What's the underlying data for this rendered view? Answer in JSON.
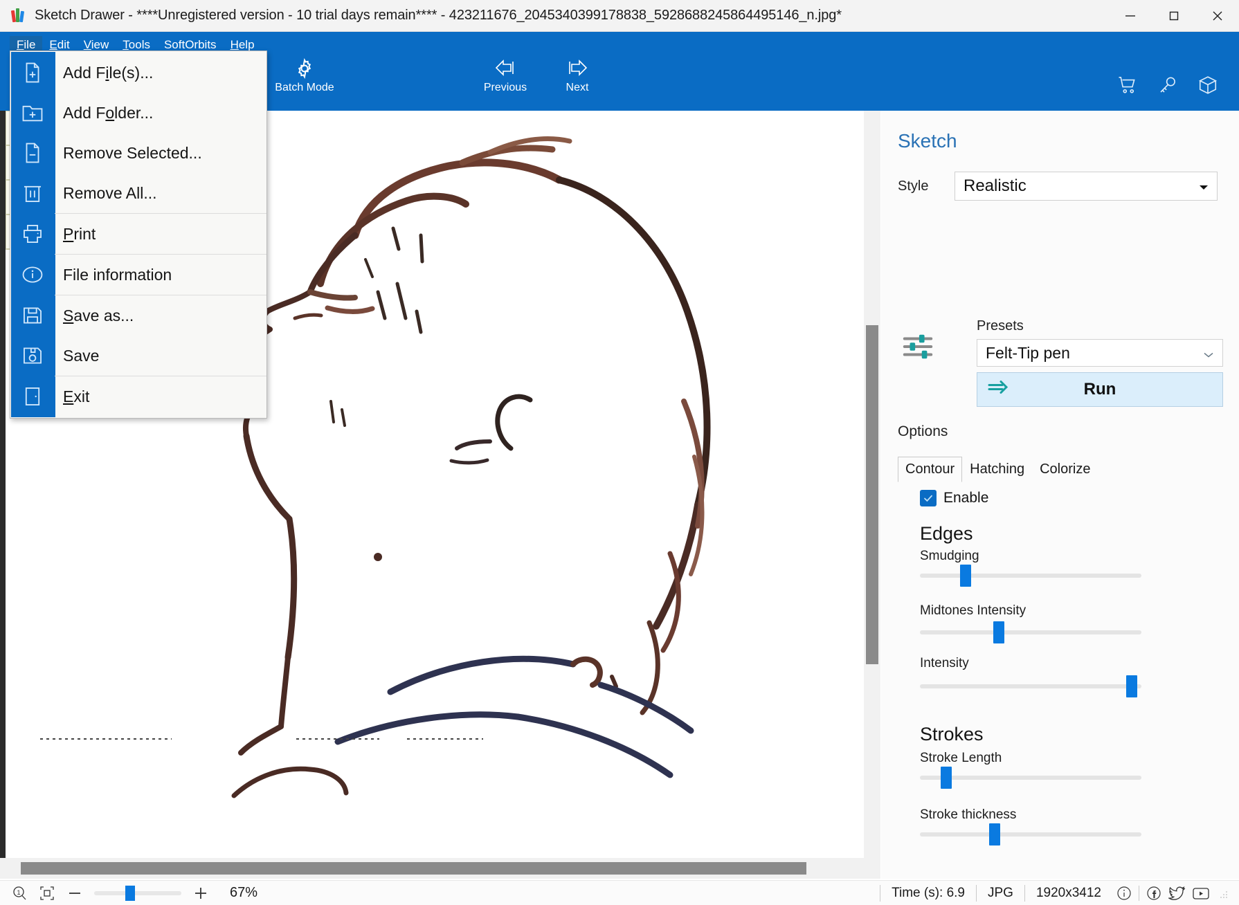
{
  "window": {
    "title": "Sketch Drawer - ****Unregistered version - 10 trial days remain**** - 423211676_2045340399178838_5928688245864495146_n.jpg*",
    "app_icon": "sketch-drawer-logo-icon",
    "minimize": "minimize-icon",
    "maximize": "maximize-icon",
    "close": "close-icon"
  },
  "menubar": {
    "items": [
      {
        "label": "File",
        "mnemonic": "F",
        "active": true
      },
      {
        "label": "Edit",
        "mnemonic": "E",
        "active": false
      },
      {
        "label": "View",
        "mnemonic": "V",
        "active": false
      },
      {
        "label": "Tools",
        "mnemonic": "T",
        "active": false
      },
      {
        "label": "SoftOrbits",
        "mnemonic": "",
        "active": false
      },
      {
        "label": "Help",
        "mnemonic": "H",
        "active": false
      }
    ]
  },
  "file_menu": {
    "items": [
      {
        "label": "Add File(s)...",
        "icon": "file-add-icon",
        "sep_after": false
      },
      {
        "label": "Add Folder...",
        "icon": "folder-add-icon",
        "sep_after": false
      },
      {
        "label": "Remove Selected...",
        "icon": "file-remove-icon",
        "sep_after": false
      },
      {
        "label": "Remove All...",
        "icon": "trash-icon",
        "sep_after": true
      },
      {
        "label": "Print",
        "icon": "printer-icon",
        "sep_after": true
      },
      {
        "label": "File information",
        "icon": "info-circle-icon",
        "sep_after": true
      },
      {
        "label": "Save as...",
        "icon": "save-as-icon",
        "sep_after": false
      },
      {
        "label": "Save",
        "icon": "save-icon",
        "sep_after": true
      },
      {
        "label": "Exit",
        "icon": "exit-door-icon",
        "sep_after": false
      }
    ]
  },
  "toolbar": {
    "batch_mode_line1": "Batch",
    "batch_mode_line2": "Mode",
    "batch_mode_icon": "gear-icon",
    "previous_label": "Previous",
    "previous_icon": "arrow-left-icon",
    "next_label": "Next",
    "next_icon": "arrow-right-icon",
    "right_icons": [
      "cart-icon",
      "key-icon",
      "box-icon"
    ]
  },
  "panel": {
    "title": "Sketch",
    "style_label": "Style",
    "style_value": "Realistic",
    "presets_label": "Presets",
    "presets_value": "Felt-Tip pen",
    "presets_icon": "sliders-icon",
    "run_label": "Run",
    "run_icon": "arrow-right-double-icon",
    "options_label": "Options",
    "tabs": [
      {
        "label": "Contour",
        "selected": true
      },
      {
        "label": "Hatching",
        "selected": false
      },
      {
        "label": "Colorize",
        "selected": false
      }
    ],
    "enable_label": "Enable",
    "enable_checked": true,
    "sections": [
      {
        "heading": "Edges",
        "sliders": [
          {
            "label": "Smudging",
            "value": 19
          },
          {
            "label": "Midtones Intensity",
            "value": 35
          },
          {
            "label": "Intensity",
            "value": 98
          }
        ]
      },
      {
        "heading": "Strokes",
        "sliders": [
          {
            "label": "Stroke Length",
            "value": 10
          },
          {
            "label": "Stroke thickness",
            "value": 33
          }
        ]
      }
    ]
  },
  "statusbar": {
    "zoom_reset_icon": "zoom-actual-size-icon",
    "zoom_fit_icon": "zoom-fit-icon",
    "zoom_out_icon": "minus-icon",
    "zoom_in_icon": "plus-icon",
    "zoom_value": "67%",
    "zoom_slider_value": 40,
    "time_label": "Time (s): 6.9",
    "format_label": "JPG",
    "dimensions_label": "1920x3412",
    "icons": [
      "info-circle-icon",
      "facebook-icon",
      "twitter-icon",
      "youtube-icon"
    ]
  },
  "colors": {
    "brand_blue": "#0a6cc4",
    "accent_blue": "#0a7ae0",
    "panel_title": "#2a72b5",
    "run_bg": "#dbeefb",
    "teal": "#1a9e9e"
  }
}
